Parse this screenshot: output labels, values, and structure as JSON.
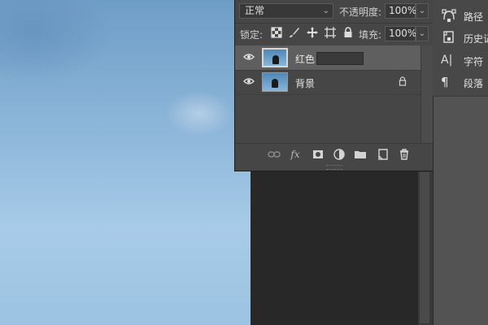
{
  "layers_panel": {
    "blend_mode": "正常",
    "opacity_label": "不透明度:",
    "opacity_value": "100%",
    "lock_label": "锁定:",
    "fill_label": "填充:",
    "fill_value": "100%",
    "layers": [
      {
        "name": "红色",
        "selected": true,
        "visible": true,
        "editing": true
      },
      {
        "name": "背景",
        "selected": false,
        "visible": true,
        "locked": true
      }
    ],
    "bottom_icons": [
      "link-icon",
      "fx-icon",
      "mask-icon",
      "adjustment-icon",
      "folder-icon",
      "new-layer-icon",
      "trash-icon"
    ],
    "fx_text": "fx"
  },
  "right_dock": {
    "items": [
      {
        "label": "路径",
        "icon": "paths-icon"
      },
      {
        "label": "历史记",
        "icon": "history-icon"
      },
      {
        "label": "字符",
        "icon": "character-icon",
        "glyph": "A|"
      },
      {
        "label": "段落",
        "icon": "paragraph-icon",
        "glyph": "¶"
      }
    ]
  },
  "colors": {
    "panel_bg": "#464646",
    "selected_row": "#5f5f5f",
    "sky": "#8db6d9",
    "dock_bg": "#535353"
  }
}
